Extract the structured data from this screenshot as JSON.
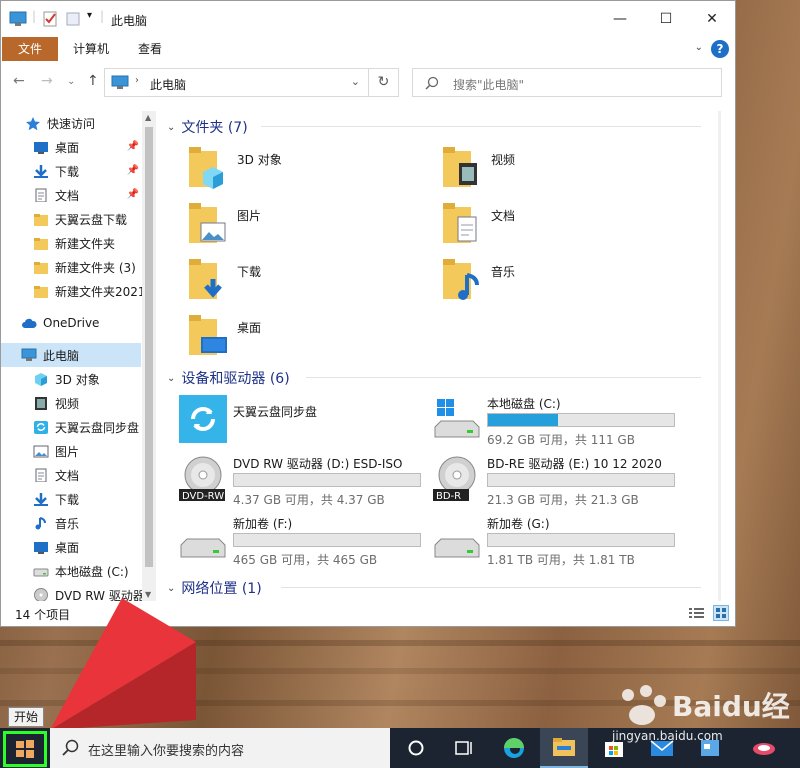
{
  "window": {
    "title": "此电脑",
    "controls": {
      "minimize": "—",
      "maximize": "☐",
      "close": "✕"
    }
  },
  "ribbon": {
    "tabs": [
      "文件",
      "计算机",
      "查看"
    ],
    "help": "?"
  },
  "address": {
    "path": "此电脑"
  },
  "search": {
    "placeholder": "搜索\"此电脑\""
  },
  "sidebar": {
    "items": [
      {
        "label": "快速访问",
        "icon": "star-icon",
        "pinned": false
      },
      {
        "label": "桌面",
        "icon": "desktop-icon",
        "pinned": true
      },
      {
        "label": "下载",
        "icon": "download-icon",
        "pinned": true
      },
      {
        "label": "文档",
        "icon": "document-icon",
        "pinned": true
      },
      {
        "label": "天翼云盘下载",
        "icon": "folder-icon",
        "pinned": false
      },
      {
        "label": "新建文件夹",
        "icon": "folder-icon",
        "pinned": false
      },
      {
        "label": "新建文件夹 (3)",
        "icon": "folder-icon",
        "pinned": false
      },
      {
        "label": "新建文件夹2021",
        "icon": "folder-icon",
        "pinned": false
      },
      {
        "label": "OneDrive",
        "icon": "cloud-icon",
        "pinned": false
      },
      {
        "label": "此电脑",
        "icon": "computer-icon",
        "pinned": false,
        "selected": true
      },
      {
        "label": "3D 对象",
        "icon": "cube-icon",
        "pinned": false
      },
      {
        "label": "视频",
        "icon": "video-icon",
        "pinned": false
      },
      {
        "label": "天翼云盘同步盘",
        "icon": "sync-icon",
        "pinned": false
      },
      {
        "label": "图片",
        "icon": "picture-icon",
        "pinned": false
      },
      {
        "label": "文档",
        "icon": "document-icon",
        "pinned": false
      },
      {
        "label": "下载",
        "icon": "download-icon",
        "pinned": false
      },
      {
        "label": "音乐",
        "icon": "music-icon",
        "pinned": false
      },
      {
        "label": "桌面",
        "icon": "desktop-icon",
        "pinned": false
      },
      {
        "label": "本地磁盘 (C:)",
        "icon": "disk-icon",
        "pinned": false
      },
      {
        "label": "DVD RW 驱动器",
        "icon": "dvd-icon",
        "pinned": false
      }
    ]
  },
  "folders": {
    "header": "文件夹 (7)",
    "items": [
      {
        "label": "3D 对象",
        "icon": "cube-folder-icon"
      },
      {
        "label": "视频",
        "icon": "video-folder-icon"
      },
      {
        "label": "图片",
        "icon": "picture-folder-icon"
      },
      {
        "label": "文档",
        "icon": "document-folder-icon"
      },
      {
        "label": "下载",
        "icon": "download-folder-icon"
      },
      {
        "label": "音乐",
        "icon": "music-folder-icon"
      },
      {
        "label": "桌面",
        "icon": "desktop-folder-icon"
      }
    ]
  },
  "devices": {
    "header": "设备和驱动器 (6)",
    "items": [
      {
        "name": "天翼云盘同步盘",
        "icon": "sync-icon",
        "free": "",
        "used_fraction": null
      },
      {
        "name": "本地磁盘 (C:)",
        "icon": "windows-disk-icon",
        "free": "69.2 GB 可用，共 111 GB",
        "used_fraction": 0.377
      },
      {
        "name": "DVD RW 驱动器 (D:) ESD-ISO",
        "icon": "dvd-icon",
        "badge": "DVD-RW",
        "free": "4.37 GB 可用，共 4.37 GB",
        "used_fraction": 0
      },
      {
        "name": "BD-RE 驱动器 (E:) 10 12 2020",
        "icon": "bd-icon",
        "badge": "BD-R",
        "free": "21.3 GB 可用，共 21.3 GB",
        "used_fraction": 0
      },
      {
        "name": "新加卷 (F:)",
        "icon": "disk-icon",
        "free": "465 GB 可用，共 465 GB",
        "used_fraction": 0
      },
      {
        "name": "新加卷 (G:)",
        "icon": "disk-icon",
        "free": "1.81 TB 可用，共 1.81 TB",
        "used_fraction": 0
      }
    ]
  },
  "network": {
    "header": "网络位置 (1)"
  },
  "status": {
    "count": "14 个项目"
  },
  "taskbar": {
    "start_tooltip": "开始",
    "search_placeholder": "在这里输入你要搜索的内容"
  },
  "watermark": {
    "main": "Baidu经验",
    "sub": "jingyan.baidu.com"
  },
  "colors": {
    "accent": "#26a0da",
    "file_tab": "#b8682a",
    "header_blue": "#1e3287",
    "arrow_red": "#e8343a",
    "start_highlight": "#2aff2a"
  }
}
